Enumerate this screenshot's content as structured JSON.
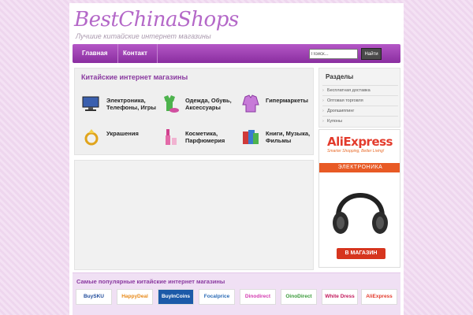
{
  "site": {
    "logo": "BestChinaShops",
    "tagline": "Лучшие китайские интернет магазины"
  },
  "nav": {
    "items": [
      "Главная",
      "Контакт"
    ],
    "search_placeholder": "Поиск...",
    "search_button": "Найти"
  },
  "categories": {
    "title": "Китайские интернет магазины",
    "items": [
      {
        "label": "Электроника, Телефоны, Игры",
        "icon": "computer-icon"
      },
      {
        "label": "Одежда, Обувь, Аксессуары",
        "icon": "clothing-icon"
      },
      {
        "label": "Гипермаркеты",
        "icon": "jacket-icon"
      },
      {
        "label": "Украшения",
        "icon": "ring-icon"
      },
      {
        "label": "Косметика, Парфюмерия",
        "icon": "cosmetics-icon"
      },
      {
        "label": "Книги, Музыка, Фильмы",
        "icon": "books-icon"
      }
    ]
  },
  "sidebar": {
    "title": "Разделы",
    "links": [
      "Бесплатная доставка",
      "Оптовая торговля",
      "Дропшиппинг",
      "Купоны"
    ]
  },
  "ad": {
    "brand": "AliExpress",
    "slogan": "Smarter Shopping, Better Living!",
    "category": "ЭЛЕКТРОНИКА",
    "button": "В МАГАЗИН"
  },
  "shops": {
    "title": "Самые популярные китайские интернет магазины",
    "logos": [
      "BuySKU",
      "HappyDeal",
      "BuyInCoins",
      "Focalprice",
      "Dinodirect",
      "OinoDirect",
      "White Dress",
      "AliExpress"
    ]
  },
  "colors": {
    "accent": "#9b3fb3",
    "nav": "#a046b5",
    "ali": "#e85a25"
  }
}
